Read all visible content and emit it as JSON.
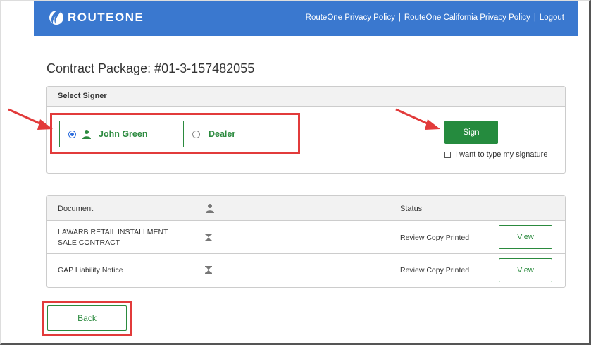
{
  "header": {
    "brand": "ROUTEONE",
    "links": [
      {
        "label": "RouteOne Privacy Policy"
      },
      {
        "label": "RouteOne California Privacy Policy"
      },
      {
        "label": "Logout"
      }
    ],
    "separator": "|"
  },
  "page_title": "Contract Package: #01-3-157482055",
  "signer_panel": {
    "heading": "Select Signer",
    "options": [
      {
        "label": "John Green",
        "selected": true
      },
      {
        "label": "Dealer",
        "selected": false
      }
    ],
    "sign_button": "Sign",
    "type_signature_label": "I want to type my signature",
    "type_signature_checked": false
  },
  "documents": {
    "columns": {
      "document": "Document",
      "signer_icon": "person-icon",
      "status": "Status"
    },
    "rows": [
      {
        "name_line1": "LAWARB RETAIL INSTALLMENT",
        "name_line2": "SALE CONTRACT",
        "status": "Review Copy Printed",
        "action": "View"
      },
      {
        "name_line1": "GAP Liability Notice",
        "name_line2": "",
        "status": "Review Copy Printed",
        "action": "View"
      }
    ]
  },
  "back_button": "Back",
  "colors": {
    "header_blue": "#3a78cf",
    "primary_green": "#258b3e",
    "highlight_red": "#e23b3b"
  }
}
